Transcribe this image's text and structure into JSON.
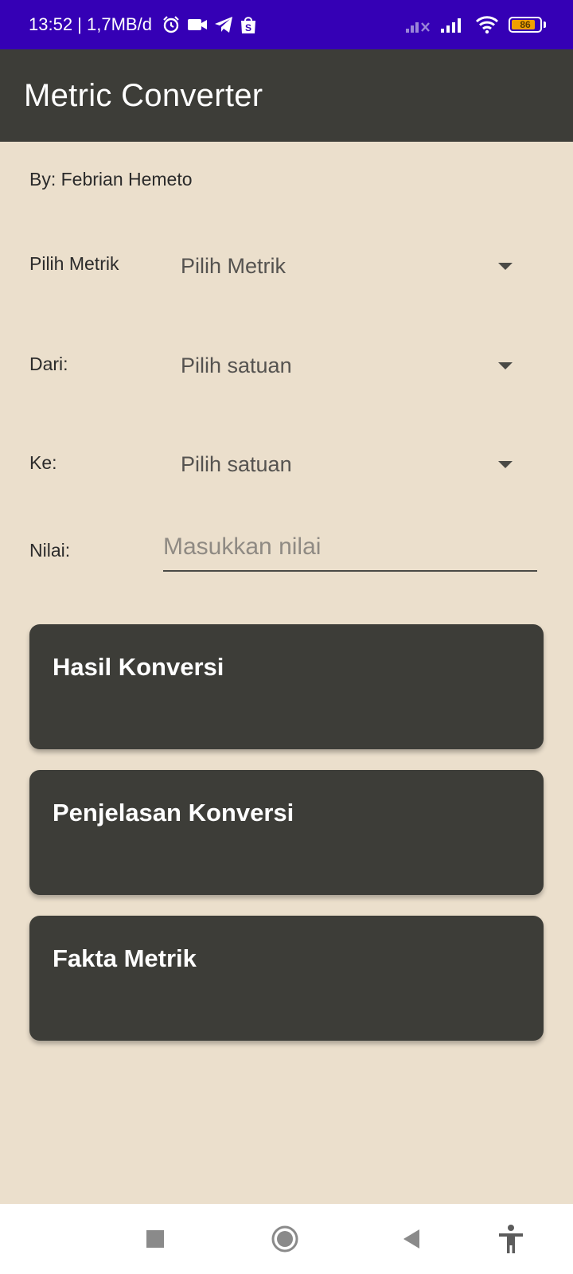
{
  "status_bar": {
    "time_info": "13:52 | 1,7MB/d",
    "battery_level": "86",
    "icons": [
      "alarm-icon",
      "video-icon",
      "telegram-icon",
      "shopee-icon",
      "no-signal-icon",
      "signal-icon",
      "wifi-icon",
      "battery-icon"
    ]
  },
  "app_bar": {
    "title": "Metric Converter"
  },
  "main": {
    "author": "By: Febrian Hemeto",
    "metric_row": {
      "label": "Pilih Metrik",
      "value": "Pilih Metrik"
    },
    "from_row": {
      "label": "Dari:",
      "value": "Pilih satuan"
    },
    "to_row": {
      "label": "Ke:",
      "value": "Pilih satuan"
    },
    "value_row": {
      "label": "Nilai:",
      "placeholder": "Masukkan nilai",
      "value": ""
    },
    "cards": [
      {
        "title": "Hasil Konversi"
      },
      {
        "title": "Penjelasan Konversi"
      },
      {
        "title": "Fakta Metrik"
      }
    ]
  },
  "nav_bar": {
    "icons": [
      "recents-icon",
      "home-icon",
      "back-icon",
      "accessibility-icon"
    ]
  },
  "colors": {
    "status_bar": "#3500b5",
    "app_bar": "#3d3d38",
    "background": "#ebdfcc",
    "card": "#3d3d38",
    "battery": "#f0a000"
  }
}
